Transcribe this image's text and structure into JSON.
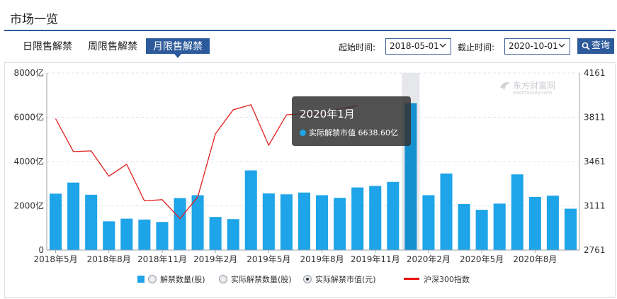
{
  "page": {
    "title": "市场一览",
    "tabs": [
      {
        "label": "日限售解禁",
        "active": false
      },
      {
        "label": "周限售解禁",
        "active": false
      },
      {
        "label": "月限售解禁",
        "active": true
      }
    ],
    "start_label": "起始时间:",
    "start_value": "2018-05-01",
    "end_label": "截止时间:",
    "end_value": "2020-10-01",
    "query_label": "查询",
    "accent_color": "#2d5a9b"
  },
  "tooltip": {
    "title": "2020年1月",
    "series_label": "实际解禁市值",
    "value": "6638.60亿"
  },
  "watermark": {
    "cn": "东方财富网",
    "en": "eastmoney.com"
  },
  "legend": [
    {
      "label": "解禁数量(股)",
      "marker": "swatch"
    },
    {
      "label": "实际解禁数量(股)",
      "marker": "radio"
    },
    {
      "label": "实际解禁市值(元)",
      "marker": "radio-checked"
    },
    {
      "label": "沪深300指数",
      "marker": "line"
    }
  ],
  "chart_data": {
    "type": "bar",
    "months": [
      "2018-05",
      "2018-06",
      "2018-07",
      "2018-08",
      "2018-09",
      "2018-10",
      "2018-11",
      "2018-12",
      "2019-01",
      "2019-02",
      "2019-03",
      "2019-04",
      "2019-05",
      "2019-06",
      "2019-07",
      "2019-08",
      "2019-09",
      "2019-10",
      "2019-11",
      "2019-12",
      "2020-01",
      "2020-02",
      "2020-03",
      "2020-04",
      "2020-05",
      "2020-06",
      "2020-07",
      "2020-08",
      "2020-09"
    ],
    "x_tick_labels": [
      "2018年5月",
      "2018年8月",
      "2018年11月",
      "2019年2月",
      "2019年5月",
      "2019年8月",
      "2019年11月",
      "2020年2月",
      "2020年5月",
      "2020年8月"
    ],
    "y_left_ticks": [
      "0",
      "2000亿",
      "4000亿",
      "6000亿",
      "8000亿"
    ],
    "y_left_range": [
      0,
      8000
    ],
    "y_right_ticks": [
      "2761",
      "3111",
      "3461",
      "3811",
      "4161"
    ],
    "y_right_range": [
      2761,
      4161
    ],
    "highlight_index": 20,
    "bar_color": "#1ea4e8",
    "highlight_color": "#1591d0",
    "line_color": "#e11d1d",
    "series": [
      {
        "name": "实际解禁市值",
        "axis": "left",
        "values": [
          2550,
          3050,
          2500,
          1300,
          1420,
          1380,
          1270,
          2350,
          2480,
          1500,
          1400,
          3600,
          2560,
          2520,
          2600,
          2480,
          2360,
          2830,
          2900,
          3080,
          6638.6,
          2480,
          3460,
          2080,
          1820,
          2100,
          3420,
          2400,
          2460,
          1870
        ]
      },
      {
        "name": "沪深300指数",
        "axis": "right",
        "values": [
          3800,
          3540,
          3545,
          3345,
          3440,
          3150,
          3160,
          3010,
          3180,
          3680,
          3870,
          3910,
          3590,
          3830,
          3840,
          3830,
          3880,
          3900
        ]
      }
    ]
  }
}
